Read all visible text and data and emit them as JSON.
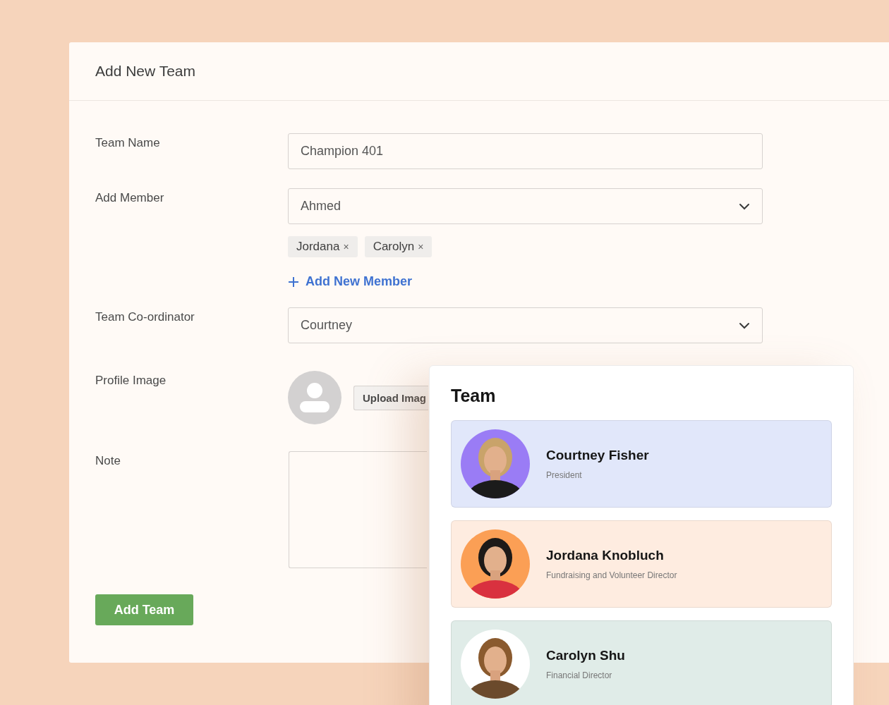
{
  "panel": {
    "title": "Add New Team"
  },
  "form": {
    "team_name": {
      "label": "Team Name",
      "value": "Champion 401"
    },
    "add_member": {
      "label": "Add Member",
      "value": "Ahmed",
      "chips": [
        {
          "label": "Jordana",
          "remove": "×"
        },
        {
          "label": "Carolyn",
          "remove": "×"
        }
      ],
      "add_link": "Add New Member"
    },
    "coordinator": {
      "label": "Team Co-ordinator",
      "value": "Courtney"
    },
    "profile_image": {
      "label": "Profile Image",
      "button": "Upload Imag"
    },
    "note": {
      "label": "Note"
    },
    "submit": "Add Team"
  },
  "team_card": {
    "title": "Team",
    "members": [
      {
        "name": "Courtney Fisher",
        "role": "President",
        "color": "#e1e7fa"
      },
      {
        "name": "Jordana Knobluch",
        "role": "Fundraising and Volunteer Director",
        "color": "#feece0"
      },
      {
        "name": "Carolyn Shu",
        "role": "Financial Director",
        "color": "#e0ece8"
      }
    ]
  }
}
